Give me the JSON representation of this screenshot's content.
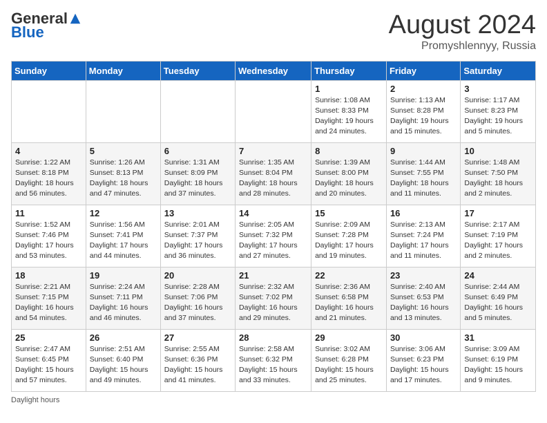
{
  "header": {
    "logo_general": "General",
    "logo_blue": "Blue",
    "month": "August 2024",
    "location": "Promyshlennyy, Russia"
  },
  "days_of_week": [
    "Sunday",
    "Monday",
    "Tuesday",
    "Wednesday",
    "Thursday",
    "Friday",
    "Saturday"
  ],
  "weeks": [
    [
      {
        "day": "",
        "info": ""
      },
      {
        "day": "",
        "info": ""
      },
      {
        "day": "",
        "info": ""
      },
      {
        "day": "",
        "info": ""
      },
      {
        "day": "1",
        "info": "Sunrise: 1:08 AM\nSunset: 8:33 PM\nDaylight: 19 hours and 24 minutes."
      },
      {
        "day": "2",
        "info": "Sunrise: 1:13 AM\nSunset: 8:28 PM\nDaylight: 19 hours and 15 minutes."
      },
      {
        "day": "3",
        "info": "Sunrise: 1:17 AM\nSunset: 8:23 PM\nDaylight: 19 hours and 5 minutes."
      }
    ],
    [
      {
        "day": "4",
        "info": "Sunrise: 1:22 AM\nSunset: 8:18 PM\nDaylight: 18 hours and 56 minutes."
      },
      {
        "day": "5",
        "info": "Sunrise: 1:26 AM\nSunset: 8:13 PM\nDaylight: 18 hours and 47 minutes."
      },
      {
        "day": "6",
        "info": "Sunrise: 1:31 AM\nSunset: 8:09 PM\nDaylight: 18 hours and 37 minutes."
      },
      {
        "day": "7",
        "info": "Sunrise: 1:35 AM\nSunset: 8:04 PM\nDaylight: 18 hours and 28 minutes."
      },
      {
        "day": "8",
        "info": "Sunrise: 1:39 AM\nSunset: 8:00 PM\nDaylight: 18 hours and 20 minutes."
      },
      {
        "day": "9",
        "info": "Sunrise: 1:44 AM\nSunset: 7:55 PM\nDaylight: 18 hours and 11 minutes."
      },
      {
        "day": "10",
        "info": "Sunrise: 1:48 AM\nSunset: 7:50 PM\nDaylight: 18 hours and 2 minutes."
      }
    ],
    [
      {
        "day": "11",
        "info": "Sunrise: 1:52 AM\nSunset: 7:46 PM\nDaylight: 17 hours and 53 minutes."
      },
      {
        "day": "12",
        "info": "Sunrise: 1:56 AM\nSunset: 7:41 PM\nDaylight: 17 hours and 44 minutes."
      },
      {
        "day": "13",
        "info": "Sunrise: 2:01 AM\nSunset: 7:37 PM\nDaylight: 17 hours and 36 minutes."
      },
      {
        "day": "14",
        "info": "Sunrise: 2:05 AM\nSunset: 7:32 PM\nDaylight: 17 hours and 27 minutes."
      },
      {
        "day": "15",
        "info": "Sunrise: 2:09 AM\nSunset: 7:28 PM\nDaylight: 17 hours and 19 minutes."
      },
      {
        "day": "16",
        "info": "Sunrise: 2:13 AM\nSunset: 7:24 PM\nDaylight: 17 hours and 11 minutes."
      },
      {
        "day": "17",
        "info": "Sunrise: 2:17 AM\nSunset: 7:19 PM\nDaylight: 17 hours and 2 minutes."
      }
    ],
    [
      {
        "day": "18",
        "info": "Sunrise: 2:21 AM\nSunset: 7:15 PM\nDaylight: 16 hours and 54 minutes."
      },
      {
        "day": "19",
        "info": "Sunrise: 2:24 AM\nSunset: 7:11 PM\nDaylight: 16 hours and 46 minutes."
      },
      {
        "day": "20",
        "info": "Sunrise: 2:28 AM\nSunset: 7:06 PM\nDaylight: 16 hours and 37 minutes."
      },
      {
        "day": "21",
        "info": "Sunrise: 2:32 AM\nSunset: 7:02 PM\nDaylight: 16 hours and 29 minutes."
      },
      {
        "day": "22",
        "info": "Sunrise: 2:36 AM\nSunset: 6:58 PM\nDaylight: 16 hours and 21 minutes."
      },
      {
        "day": "23",
        "info": "Sunrise: 2:40 AM\nSunset: 6:53 PM\nDaylight: 16 hours and 13 minutes."
      },
      {
        "day": "24",
        "info": "Sunrise: 2:44 AM\nSunset: 6:49 PM\nDaylight: 16 hours and 5 minutes."
      }
    ],
    [
      {
        "day": "25",
        "info": "Sunrise: 2:47 AM\nSunset: 6:45 PM\nDaylight: 15 hours and 57 minutes."
      },
      {
        "day": "26",
        "info": "Sunrise: 2:51 AM\nSunset: 6:40 PM\nDaylight: 15 hours and 49 minutes."
      },
      {
        "day": "27",
        "info": "Sunrise: 2:55 AM\nSunset: 6:36 PM\nDaylight: 15 hours and 41 minutes."
      },
      {
        "day": "28",
        "info": "Sunrise: 2:58 AM\nSunset: 6:32 PM\nDaylight: 15 hours and 33 minutes."
      },
      {
        "day": "29",
        "info": "Sunrise: 3:02 AM\nSunset: 6:28 PM\nDaylight: 15 hours and 25 minutes."
      },
      {
        "day": "30",
        "info": "Sunrise: 3:06 AM\nSunset: 6:23 PM\nDaylight: 15 hours and 17 minutes."
      },
      {
        "day": "31",
        "info": "Sunrise: 3:09 AM\nSunset: 6:19 PM\nDaylight: 15 hours and 9 minutes."
      }
    ]
  ],
  "footer": {
    "daylight_hours": "Daylight hours"
  }
}
